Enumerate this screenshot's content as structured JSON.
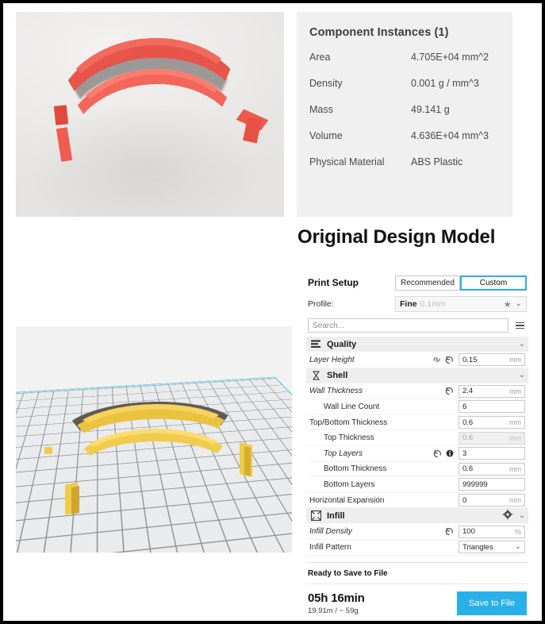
{
  "caption": "Original Design Model",
  "component_info": {
    "title": "Component Instances (1)",
    "rows": [
      {
        "label": "Area",
        "value": "4.705E+04 mm^2"
      },
      {
        "label": "Density",
        "value": "0.001 g / mm^3"
      },
      {
        "label": "Mass",
        "value": "49.141 g"
      },
      {
        "label": "Volume",
        "value": "4.636E+04 mm^3"
      },
      {
        "label": "Physical Material",
        "value": "ABS Plastic"
      }
    ]
  },
  "photo": {
    "alt": "red 3d printed face shield headband",
    "part_color": "#f05a4e",
    "background_color": "#ededed"
  },
  "viewport": {
    "alt": "cura build plate with yellow model",
    "model_color": "#efcb4b",
    "plate_color": "#e9ebec",
    "plate_outline_color": "#77c9de"
  },
  "cura": {
    "print_setup_title": "Print Setup",
    "mode_tabs": [
      {
        "label": "Recommended",
        "active": false
      },
      {
        "label": "Custom",
        "active": true
      }
    ],
    "profile_label": "Profile:",
    "profile_name": "Fine",
    "profile_sub": "0.1mm",
    "profile_star_icon": "star-icon",
    "profile_chevron_icon": "chevron-down-icon",
    "search_placeholder": "Search...",
    "menu_icon": "hamburger-menu-icon",
    "accent_color": "#2ab0e5",
    "categories": [
      {
        "name": "Quality",
        "icon": "layers-icon",
        "gear": false,
        "settings": [
          {
            "label": "Layer Height",
            "italic": true,
            "indent": 0,
            "link": true,
            "revert": true,
            "info": false,
            "value": "0.15",
            "unit": "mm",
            "disabled": false,
            "dropdown": false
          }
        ]
      },
      {
        "name": "Shell",
        "icon": "shell-icon",
        "gear": false,
        "settings": [
          {
            "label": "Wall Thickness",
            "italic": true,
            "indent": 0,
            "link": false,
            "revert": true,
            "info": false,
            "value": "2.4",
            "unit": "mm",
            "disabled": false,
            "dropdown": false
          },
          {
            "label": "Wall Line Count",
            "italic": false,
            "indent": 1,
            "link": false,
            "revert": false,
            "info": false,
            "value": "6",
            "unit": "",
            "disabled": false,
            "dropdown": false
          },
          {
            "label": "Top/Bottom Thickness",
            "italic": false,
            "indent": 0,
            "link": false,
            "revert": false,
            "info": false,
            "value": "0.6",
            "unit": "mm",
            "disabled": false,
            "dropdown": false
          },
          {
            "label": "Top Thickness",
            "italic": false,
            "indent": 1,
            "link": false,
            "revert": false,
            "info": false,
            "value": "0.6",
            "unit": "mm",
            "disabled": true,
            "dropdown": false
          },
          {
            "label": "Top Layers",
            "italic": true,
            "indent": 1,
            "link": false,
            "revert": true,
            "info": true,
            "value": "3",
            "unit": "",
            "disabled": false,
            "dropdown": false
          },
          {
            "label": "Bottom Thickness",
            "italic": false,
            "indent": 1,
            "link": false,
            "revert": false,
            "info": false,
            "value": "0.6",
            "unit": "mm",
            "disabled": false,
            "dropdown": false
          },
          {
            "label": "Bottom Layers",
            "italic": false,
            "indent": 1,
            "link": false,
            "revert": false,
            "info": false,
            "value": "999999",
            "unit": "",
            "disabled": false,
            "dropdown": false
          },
          {
            "label": "Horizontal Expansion",
            "italic": false,
            "indent": 0,
            "link": false,
            "revert": false,
            "info": false,
            "value": "0",
            "unit": "mm",
            "disabled": false,
            "dropdown": false
          }
        ]
      },
      {
        "name": "Infill",
        "icon": "infill-grid-icon",
        "gear": true,
        "settings": [
          {
            "label": "Infill Density",
            "italic": true,
            "indent": 0,
            "link": false,
            "revert": true,
            "info": false,
            "value": "100",
            "unit": "%",
            "disabled": false,
            "dropdown": false
          },
          {
            "label": "Infill Pattern",
            "italic": false,
            "indent": 0,
            "link": false,
            "revert": false,
            "info": false,
            "value": "Triangles",
            "unit": "",
            "disabled": false,
            "dropdown": true
          }
        ]
      }
    ],
    "status_text": "Ready to Save to File",
    "print_time": "05h 16min",
    "print_material": "19.91m / ~ 59g",
    "save_button_label": "Save to File"
  }
}
